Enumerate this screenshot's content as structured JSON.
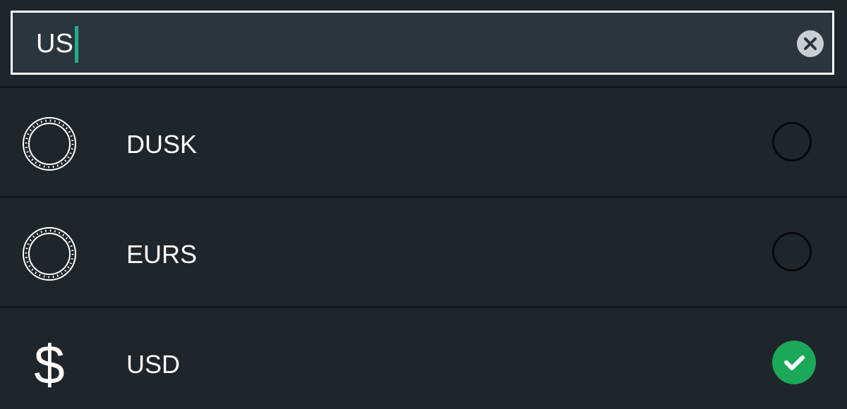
{
  "search": {
    "value": "US"
  },
  "results": [
    {
      "label": "DUSK",
      "icon": "coin-outline-icon",
      "selected": false
    },
    {
      "label": "EURS",
      "icon": "coin-outline-icon",
      "selected": false
    },
    {
      "label": "USD",
      "icon": "dollar-sign-icon",
      "selected": true
    }
  ],
  "colors": {
    "background": "#1e252b",
    "search_field": "#2b353d",
    "caret": "#1fae8e",
    "selected": "#1ba858"
  }
}
